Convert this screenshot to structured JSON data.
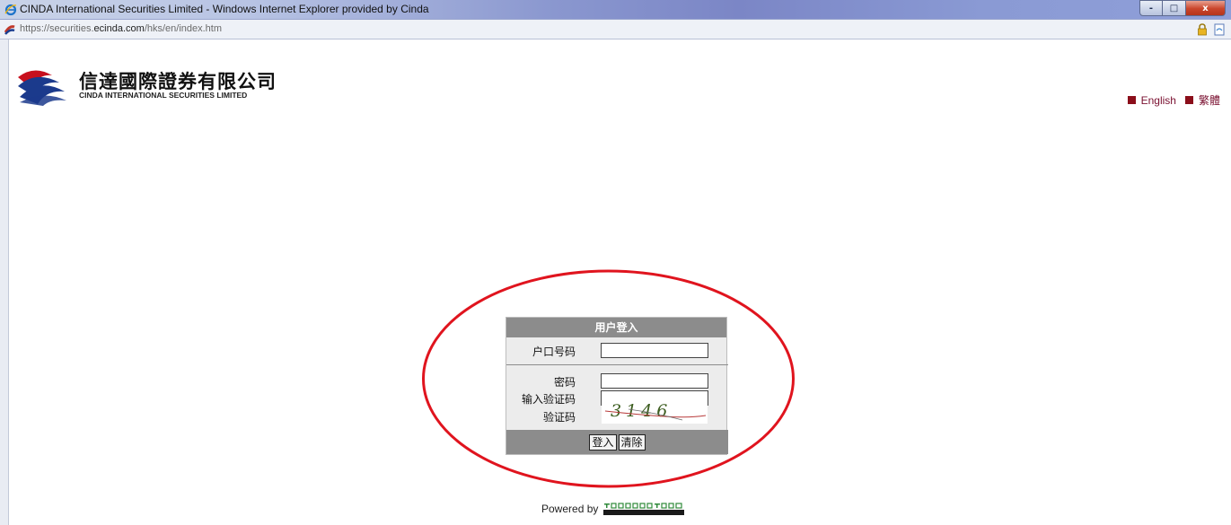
{
  "window": {
    "title": "CINDA International Securities Limited - Windows Internet Explorer provided by Cinda",
    "controls": {
      "minimize": "-",
      "maximize": "□",
      "close": "x"
    }
  },
  "address_bar": {
    "url_prefix": "https://securities.",
    "url_host": "ecinda.com",
    "url_path": "/hks/en/index.htm"
  },
  "header": {
    "logo_chinese": "信達國際證券有限公司",
    "logo_english": "CINDA INTERNATIONAL SECURITIES LIMITED",
    "languages": [
      "English",
      "繁體"
    ]
  },
  "login": {
    "title": "用户登入",
    "account_label": "户口号码",
    "password_label": "密码",
    "captcha_input_label": "输入验证码",
    "captcha_label": "验证码",
    "captcha_text": "3146",
    "login_button": "登入",
    "clear_button": "清除"
  },
  "footer": {
    "powered_by": "Powered by",
    "vendor_logo": "TRANSACTION TECHNOLOGIES"
  },
  "colors": {
    "login_header_bg": "#8c8c8c",
    "login_body_bg": "#ececec",
    "highlight_ellipse": "#e0141e",
    "lang_bullet": "#8b0e1a"
  }
}
